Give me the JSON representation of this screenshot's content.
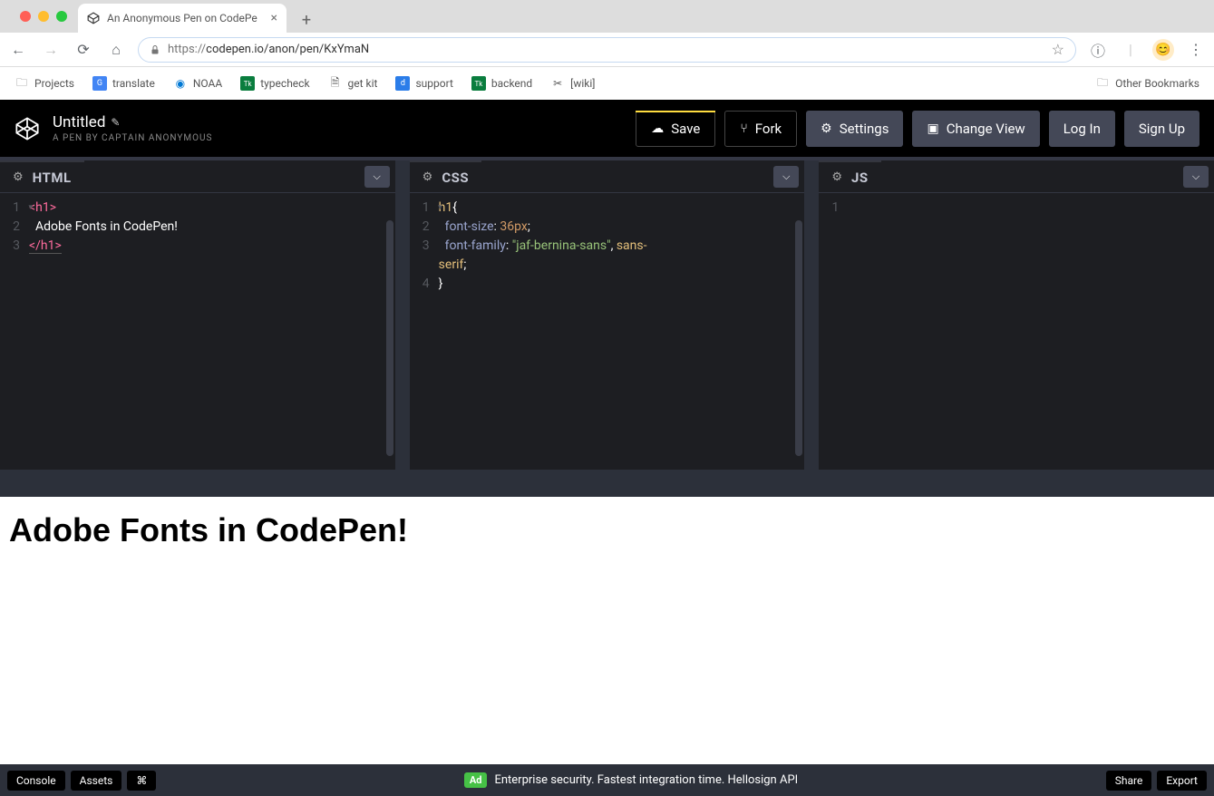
{
  "browser": {
    "tab_title": "An Anonymous Pen on CodePe",
    "url_scheme": "https://",
    "url_rest": "codepen.io/anon/pen/KxYmaN",
    "bookmarks": [
      {
        "label": "Projects",
        "icon": "folder"
      },
      {
        "label": "translate",
        "icon": "g"
      },
      {
        "label": "NOAA",
        "icon": "noaa"
      },
      {
        "label": "typecheck",
        "icon": "tk"
      },
      {
        "label": "get kit",
        "icon": "doc"
      },
      {
        "label": "support",
        "icon": "d"
      },
      {
        "label": "backend",
        "icon": "tk"
      },
      {
        "label": "[wiki]",
        "icon": "wiki"
      }
    ],
    "other_bookmarks": "Other Bookmarks"
  },
  "codepen": {
    "title": "Untitled",
    "subtitle": "A PEN BY CAPTAIN ANONYMOUS",
    "buttons": {
      "save": "Save",
      "fork": "Fork",
      "settings": "Settings",
      "change_view": "Change View",
      "login": "Log In",
      "signup": "Sign Up"
    }
  },
  "editors": {
    "html": {
      "title": "HTML",
      "lines": [
        {
          "n": "1",
          "tag_open": "<h1>"
        },
        {
          "n": "2",
          "text": "  Adobe Fonts in CodePen!"
        },
        {
          "n": "3",
          "tag_close": "</h1>"
        }
      ]
    },
    "css": {
      "title": "CSS",
      "l1_sel": "h1",
      "l1_brace": "{",
      "l2_prop": "font-size",
      "l2_colon": ": ",
      "l2_val": "36px",
      "l2_semi": ";",
      "l3_prop": "font-family",
      "l3_colon": ": ",
      "l3_str": "\"jaf-bernina-sans\"",
      "l3_comma": ", ",
      "l3_kw1": "sans-",
      "l3b_kw2": "serif",
      "l3b_semi": ";",
      "l4_brace": "}"
    },
    "js": {
      "title": "JS",
      "line1": "1"
    }
  },
  "preview": {
    "heading": "Adobe Fonts in CodePen!"
  },
  "footer": {
    "console": "Console",
    "assets": "Assets",
    "cmd": "⌘",
    "ad_badge": "Ad",
    "ad_text": "Enterprise security. Fastest integration time. Hellosign API",
    "share": "Share",
    "export": "Export"
  }
}
